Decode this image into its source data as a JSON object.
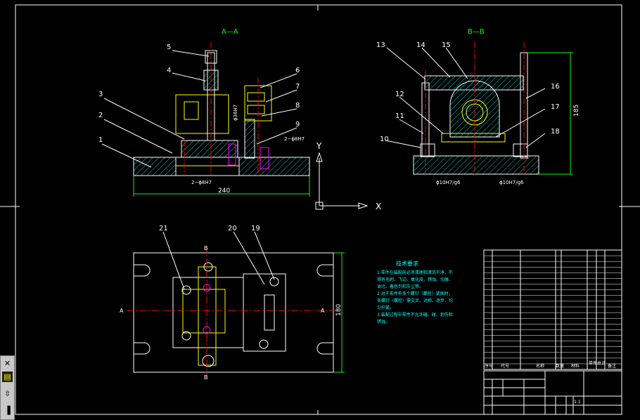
{
  "views": {
    "section_a_title": "A—A",
    "section_b_title": "B—B",
    "dim_width": "240",
    "dim_height_right": "185",
    "dim_plan_height": "180",
    "dim_holes_left": "2−ϕ8H7",
    "dim_holes_mid": "2−ϕ8H7",
    "dim_phi_b_left": "ϕ10H7/g6",
    "dim_phi_b_right": "ϕ10H7/g6",
    "dim_phi_vertical": "ϕ36H7"
  },
  "callouts": {
    "a": [
      "1",
      "2",
      "3",
      "4",
      "5",
      "6",
      "7",
      "8",
      "9"
    ],
    "b": [
      "10",
      "11",
      "12",
      "13",
      "14",
      "15",
      "16",
      "17",
      "18"
    ],
    "plan": [
      "19",
      "20",
      "21"
    ]
  },
  "axes": {
    "x": "X",
    "y": "Y"
  },
  "section_marks": {
    "a_left": "A",
    "a_right": "A",
    "b_top": "B",
    "b_bottom": "B"
  },
  "tech_req": {
    "title": "技术要求",
    "lines": [
      "1.零件在装配前必须清理和清洗干净，不",
      "得有毛刺、飞边、氧化皮、锈蚀、切屑、",
      "油污、着色剂和灰尘等。",
      "2.对于零件有多个螺钉（螺栓）紧固时，",
      "各螺钉（螺栓）需交叉、对称、逐步、均",
      "匀拧紧。",
      "3.装配过程中零件不允许磕、碰、划伤和",
      "锈蚀。"
    ]
  },
  "bom_header": [
    "序号",
    "代号",
    "名称",
    "数量",
    "材料",
    "单件",
    "总计",
    "备注"
  ],
  "title_block": {
    "scale": "1:1"
  },
  "toolbox": {
    "icons": [
      "cross-icon",
      "layer-icon",
      "move-icon",
      "grip-icon"
    ]
  }
}
